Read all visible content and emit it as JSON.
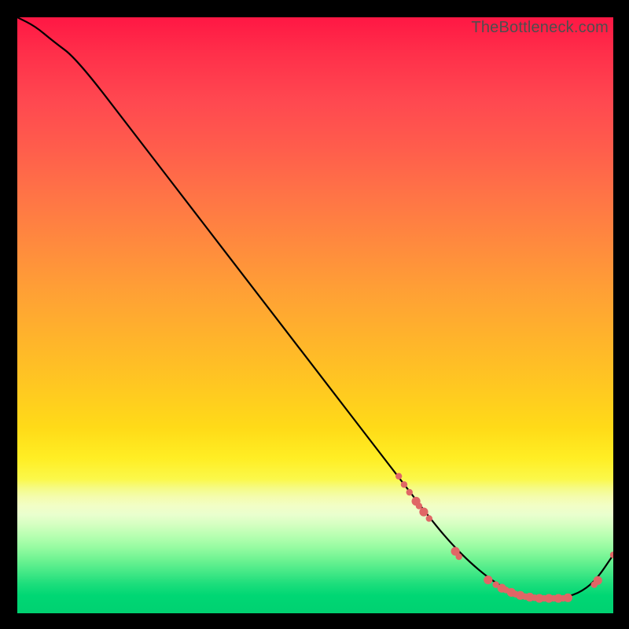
{
  "watermark": "TheBottleneck.com",
  "chart_data": {
    "type": "line",
    "title": "",
    "xlabel": "",
    "ylabel": "",
    "xlim": [
      0,
      100
    ],
    "ylim": [
      0,
      100
    ],
    "grid": false,
    "legend": false,
    "series": [
      {
        "name": "bottleneck-curve",
        "color": "#000000",
        "x": [
          0,
          3,
          6,
          10,
          20,
          30,
          40,
          50,
          60,
          65,
          70,
          73,
          76,
          79,
          82,
          85,
          88,
          91,
          94,
          97,
          100
        ],
        "y": [
          100,
          98.5,
          96,
          93,
          80,
          67,
          54,
          41,
          28,
          21.5,
          15,
          11.5,
          8.5,
          6,
          4,
          3,
          2.6,
          2.6,
          3.2,
          5.4,
          9.8
        ]
      }
    ],
    "markers": {
      "name": "highlighted-points",
      "color": "#e06666",
      "radius_small": 4.2,
      "radius_large": 5.6,
      "points": [
        {
          "x": 64.0,
          "y": 23.0,
          "r": "s"
        },
        {
          "x": 64.9,
          "y": 21.6,
          "r": "s"
        },
        {
          "x": 65.8,
          "y": 20.3,
          "r": "s"
        },
        {
          "x": 66.9,
          "y": 18.8,
          "r": "l"
        },
        {
          "x": 67.4,
          "y": 18.0,
          "r": "s"
        },
        {
          "x": 68.2,
          "y": 17.0,
          "r": "l"
        },
        {
          "x": 69.1,
          "y": 15.9,
          "r": "s"
        },
        {
          "x": 73.5,
          "y": 10.4,
          "r": "l"
        },
        {
          "x": 74.1,
          "y": 9.5,
          "r": "s"
        },
        {
          "x": 79.0,
          "y": 5.6,
          "r": "l"
        },
        {
          "x": 80.3,
          "y": 4.8,
          "r": "s"
        },
        {
          "x": 81.3,
          "y": 4.2,
          "r": "l"
        },
        {
          "x": 82.0,
          "y": 3.9,
          "r": "s"
        },
        {
          "x": 82.9,
          "y": 3.5,
          "r": "l"
        },
        {
          "x": 83.6,
          "y": 3.2,
          "r": "s"
        },
        {
          "x": 84.4,
          "y": 3.0,
          "r": "l"
        },
        {
          "x": 85.2,
          "y": 2.8,
          "r": "s"
        },
        {
          "x": 86.0,
          "y": 2.7,
          "r": "l"
        },
        {
          "x": 86.8,
          "y": 2.6,
          "r": "s"
        },
        {
          "x": 87.6,
          "y": 2.5,
          "r": "l"
        },
        {
          "x": 88.4,
          "y": 2.5,
          "r": "s"
        },
        {
          "x": 89.2,
          "y": 2.5,
          "r": "l"
        },
        {
          "x": 90.0,
          "y": 2.5,
          "r": "s"
        },
        {
          "x": 90.8,
          "y": 2.5,
          "r": "l"
        },
        {
          "x": 91.6,
          "y": 2.5,
          "r": "s"
        },
        {
          "x": 92.4,
          "y": 2.6,
          "r": "l"
        },
        {
          "x": 96.8,
          "y": 4.8,
          "r": "s"
        },
        {
          "x": 97.4,
          "y": 5.5,
          "r": "l"
        },
        {
          "x": 100.0,
          "y": 9.8,
          "r": "s"
        }
      ]
    }
  }
}
